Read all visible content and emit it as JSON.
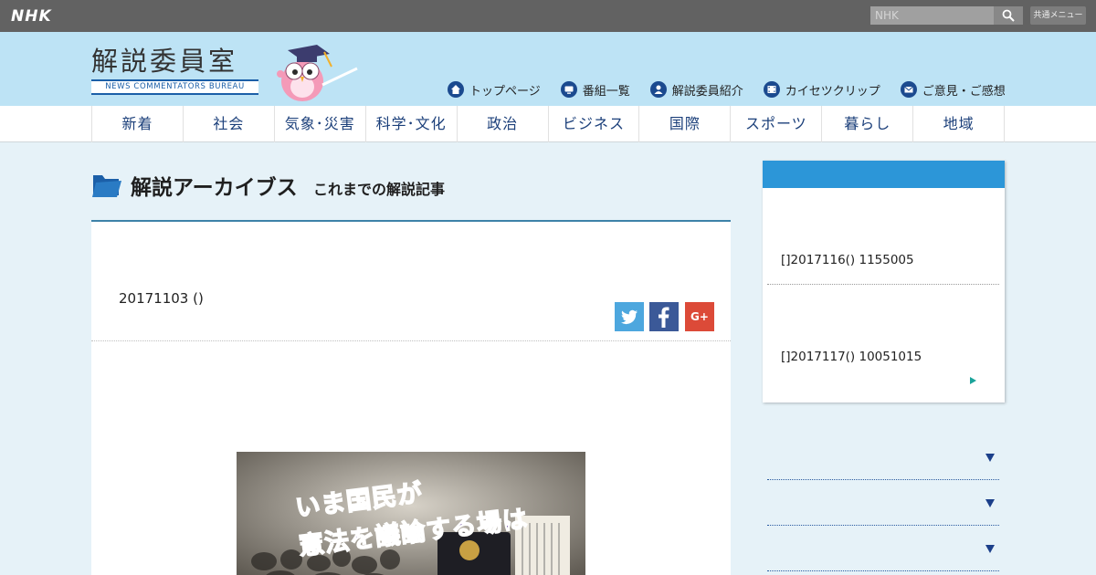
{
  "global_bar": {
    "logo": "NHK",
    "search_placeholder": "NHK",
    "menu_label": "共通メニュー"
  },
  "header": {
    "site_title": "解説委員室",
    "site_subtitle": "NEWS COMMENTATORS BUREAU",
    "links": [
      {
        "label": "トップページ",
        "icon": "home-icon"
      },
      {
        "label": "番組一覧",
        "icon": "tv-icon"
      },
      {
        "label": "解説委員紹介",
        "icon": "person-icon"
      },
      {
        "label": "カイセツクリップ",
        "icon": "film-icon"
      },
      {
        "label": "ご意見・ご感想",
        "icon": "mail-icon"
      }
    ]
  },
  "categories": [
    "新着",
    "社会",
    "気象･災害",
    "科学･文化",
    "政治",
    "ビジネス",
    "国際",
    "スポーツ",
    "暮らし",
    "地域"
  ],
  "archive": {
    "title": "解説アーカイブス",
    "subtitle": "これまでの解説記事"
  },
  "article": {
    "date": "20171103 ()",
    "share": {
      "googleplus_label": "G+"
    },
    "image_text_line1": "いま国民が",
    "image_text_line2": "憲法を議論する場は"
  },
  "sidebar": {
    "items": [
      "[]2017116() 1155005",
      "[]2017117() 10051015"
    ]
  },
  "colors": {
    "header_bg": "#bde3f5",
    "page_bg": "#e6f2f8",
    "accent_blue": "#2c96d8",
    "nav_text": "#1b3f7a",
    "twitter": "#4da7de",
    "facebook": "#3b5998",
    "googleplus": "#dc4a38"
  }
}
